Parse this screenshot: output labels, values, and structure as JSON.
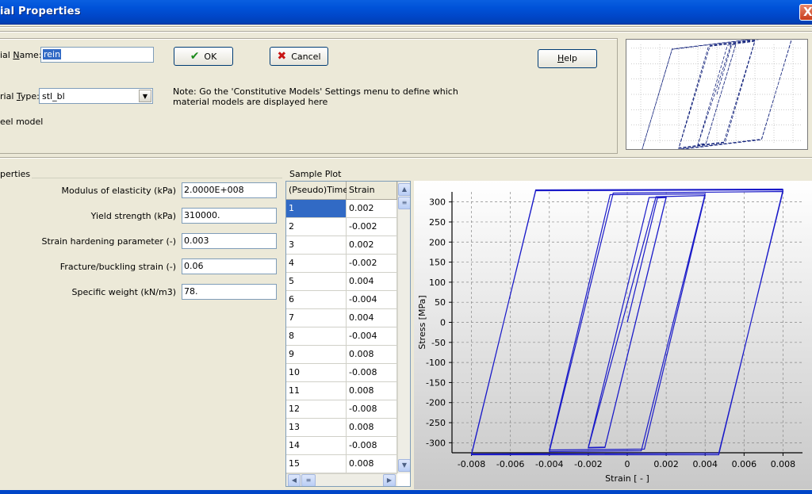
{
  "window": {
    "title": "ial Properties",
    "close_glyph": "X"
  },
  "header": {
    "name_label_prefix": "ial ",
    "name_label_key": "N",
    "name_label_suffix": "ame:",
    "name_value": "rein",
    "type_label_prefix": "rial ",
    "type_label_key": "T",
    "type_label_suffix": "ype:",
    "type_value": "stl_bl",
    "model_caption": "eel model",
    "note_line1": "Note: Go the 'Constitutive Models' Settings menu to define which",
    "note_line2": "material models are displayed here",
    "ok_label": "OK",
    "cancel_label": "Cancel",
    "help_label": "Help",
    "help_key": "H",
    "help_rest": "elp"
  },
  "properties": {
    "group_title": "perties",
    "items": [
      {
        "label": "Modulus of elasticity (kPa)",
        "value": "2.0000E+008"
      },
      {
        "label": "Yield strength (kPa)",
        "value": "310000."
      },
      {
        "label": "Strain hardening parameter (-)",
        "value": "0.003"
      },
      {
        "label": "Fracture/buckling strain (-)",
        "value": "0.06"
      },
      {
        "label": "Specific weight (kN/m3)",
        "value": "78."
      }
    ]
  },
  "sample_plot": {
    "group_title": "Sample Plot",
    "columns": [
      "(Pseudo)Time",
      "Strain"
    ],
    "rows": [
      [
        "1",
        "0.002"
      ],
      [
        "2",
        "-0.002"
      ],
      [
        "3",
        "0.002"
      ],
      [
        "4",
        "-0.002"
      ],
      [
        "5",
        "0.004"
      ],
      [
        "6",
        "-0.004"
      ],
      [
        "7",
        "0.004"
      ],
      [
        "8",
        "-0.004"
      ],
      [
        "9",
        "0.008"
      ],
      [
        "10",
        "-0.008"
      ],
      [
        "11",
        "0.008"
      ],
      [
        "12",
        "-0.008"
      ],
      [
        "13",
        "0.008"
      ],
      [
        "14",
        "-0.008"
      ],
      [
        "15",
        "0.008"
      ]
    ],
    "selected_row": 0
  },
  "chart_data": {
    "type": "line",
    "title": "",
    "xlabel": "Strain [ - ]",
    "ylabel": "Stress [MPa]",
    "xlim": [
      -0.009,
      0.009
    ],
    "ylim": [
      -325,
      325
    ],
    "xticks": [
      -0.008,
      -0.006,
      -0.004,
      -0.002,
      0,
      0.002,
      0.004,
      0.006,
      0.008
    ],
    "xtick_labels": [
      "-0.008",
      "-0.006",
      "-0.004",
      "-0.002",
      "0",
      "0.002",
      "0.004",
      "0.006",
      "0.008"
    ],
    "yticks": [
      -300,
      -250,
      -200,
      -150,
      -100,
      -50,
      0,
      50,
      100,
      150,
      200,
      250,
      300
    ],
    "ytick_labels": [
      "-300",
      "-250",
      "-200",
      "-150",
      "-100",
      "-50",
      "0",
      "50",
      "100",
      "150",
      "200",
      "250",
      "300"
    ],
    "grid": true,
    "line_color": "#1a1ac8",
    "series": [
      {
        "x": [
          0,
          0.00155,
          0.002,
          -0.00114,
          -0.002,
          0.00112,
          0.002,
          -0.00115,
          -0.002,
          0.00148,
          0.004,
          0.00088,
          -0.004,
          -0.00088,
          0.004,
          0.00072,
          -0.004,
          -0.00072,
          0.008,
          0.0047,
          -0.008,
          -0.0047,
          0.008,
          0.0047,
          -0.008,
          -0.0047,
          0.008
        ],
        "y": [
          0,
          310,
          311,
          -311,
          -312,
          311,
          312,
          -312,
          -313,
          313,
          316,
          -316,
          -318,
          318,
          320,
          -320,
          -322,
          322,
          326,
          -326,
          -328,
          328,
          330,
          -330,
          -330,
          330,
          332
        ]
      }
    ]
  },
  "colors": {
    "titlebar": "#0053d9",
    "selection": "#316ac5",
    "dialog_bg": "#ece9d8"
  }
}
